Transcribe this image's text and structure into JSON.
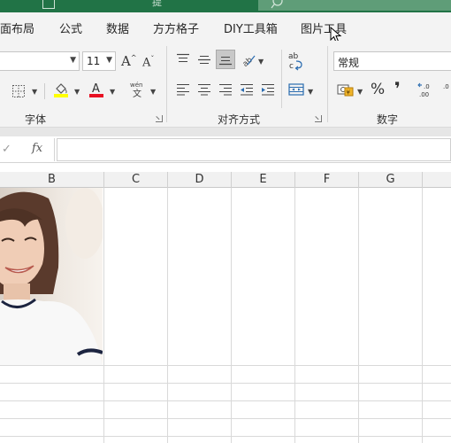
{
  "ribbon_tabs": [
    "面布局",
    "公式",
    "数据",
    "方方格子",
    "DIY工具箱",
    "图片工具"
  ],
  "title_fragment": "提",
  "font": {
    "size": "11",
    "grow_label": "A",
    "shrink_label": "A",
    "phonetic_top": "wén",
    "phonetic_bottom": "文",
    "group_label": "字体",
    "fill_color": "#ffff00",
    "font_color": "#e81123"
  },
  "alignment": {
    "group_label": "对齐方式",
    "wrap_label": "ab",
    "wrap_sub": "c"
  },
  "number": {
    "format_value": "常规",
    "percent_label": "%",
    "comma_label": "❜",
    "group_label": "数字"
  },
  "formula_bar": {
    "fx_label": "fx",
    "check_label": "✓",
    "value": ""
  },
  "columns": [
    "B",
    "C",
    "D",
    "E",
    "F",
    "G"
  ],
  "icons": [
    "border-icon",
    "fill-color-icon",
    "font-color-icon",
    "phonetic-icon",
    "align-top-icon",
    "align-middle-icon",
    "align-bottom-icon",
    "orientation-icon",
    "wrap-text-icon",
    "align-left-icon",
    "align-center-icon",
    "align-right-icon",
    "decrease-indent-icon",
    "increase-indent-icon",
    "merge-center-icon",
    "accounting-format-icon",
    "increase-decimal-icon",
    "mouse-cursor-icon"
  ],
  "accent_color": "#217346"
}
